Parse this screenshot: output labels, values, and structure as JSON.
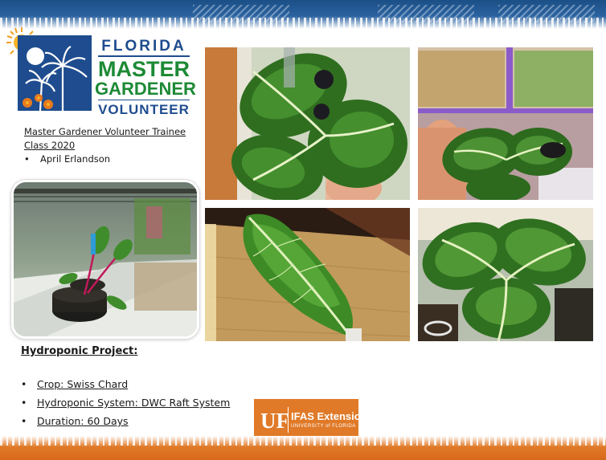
{
  "logo": {
    "line1": "FLORIDA",
    "line2": "MASTER",
    "line3": "GARDENER",
    "line4": "VOLUNTEER"
  },
  "trainee": {
    "line1": "Master Gardener Volunteer Trainee",
    "line2": "Class 2020",
    "name": "April Erlandson"
  },
  "project": {
    "title": "Hydroponic Project:",
    "items": [
      "Crop: Swiss Chard",
      "Hydroponic System:  DWC Raft System",
      "Duration: 60 Days"
    ]
  },
  "badge": {
    "uf": "UF",
    "ifas": "IFAS Extension",
    "university": "UNIVERSITY of FLORIDA"
  },
  "colors": {
    "brand_blue": "#1e4c8e",
    "brand_green": "#1d8a36",
    "accent_orange": "#e07a28"
  }
}
